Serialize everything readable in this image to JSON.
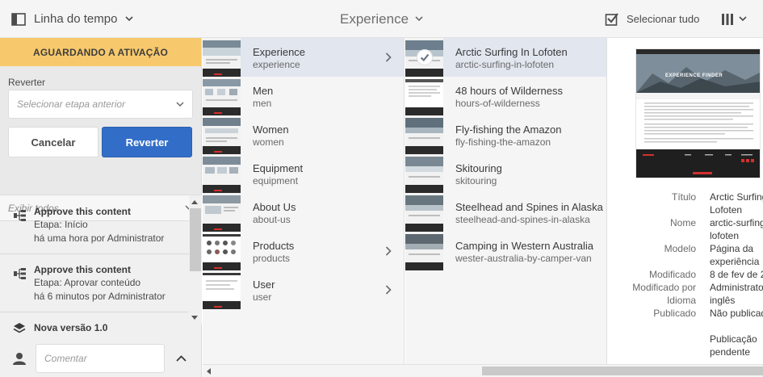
{
  "topbar": {
    "rail_title": "Linha do tempo",
    "breadcrumb": "Experience",
    "select_all": "Selecionar tudo"
  },
  "rail": {
    "banner": "AGUARDANDO A ATIVAÇÃO",
    "revert_label": "Reverter",
    "revert_select_placeholder": "Selecionar etapa anterior",
    "cancel_label": "Cancelar",
    "revert_button": "Reverter",
    "filter_label": "Exibir todos",
    "timeline": [
      {
        "title": "Approve this content",
        "step": "Etapa: Início",
        "time": "há uma hora por Administrator"
      },
      {
        "title": "Approve this content",
        "step": "Etapa: Aprovar conteúdo",
        "time": "há 6 minutos por Administrator"
      }
    ],
    "version": "Nova versão 1.0",
    "comment_placeholder": "Comentar"
  },
  "column1": [
    {
      "title": "Experience",
      "name": "experience",
      "has_children": true,
      "active": true
    },
    {
      "title": "Men",
      "name": "men",
      "has_children": false
    },
    {
      "title": "Women",
      "name": "women",
      "has_children": false
    },
    {
      "title": "Equipment",
      "name": "equipment",
      "has_children": false
    },
    {
      "title": "About Us",
      "name": "about-us",
      "has_children": false
    },
    {
      "title": "Products",
      "name": "products",
      "has_children": true
    },
    {
      "title": "User",
      "name": "user",
      "has_children": true
    }
  ],
  "column2": [
    {
      "title": "Arctic Surfing In Lofoten",
      "name": "arctic-surfing-in-lofoten",
      "selected": true
    },
    {
      "title": "48 hours of Wilderness",
      "name": "hours-of-wilderness"
    },
    {
      "title": "Fly-fishing the Amazon",
      "name": "fly-fishing-the-amazon"
    },
    {
      "title": "Skitouring",
      "name": "skitouring"
    },
    {
      "title": "Steelhead and Spines in Alaska",
      "name": "steelhead-and-spines-in-alaska"
    },
    {
      "title": "Camping in Western Australia",
      "name": "wester-australia-by-camper-van"
    }
  ],
  "preview": {
    "hero_text": "EXPERIENCE FINDER",
    "meta": {
      "titulo_label": "Título",
      "titulo_value_1": "Arctic Surfing",
      "titulo_value_2": "Lofoten",
      "nome_label": "Nome",
      "nome_value_1": "arctic-surfing-",
      "nome_value_2": "lofoten",
      "modelo_label": "Modelo",
      "modelo_value_1": "Página da",
      "modelo_value_2": "experiência",
      "modificado_label": "Modificado",
      "modificado_value": "8 de fev de 20",
      "modificado_por_label": "Modificado por",
      "modificado_por_value": "Administrator",
      "idioma_label": "Idioma",
      "idioma_value": "inglês",
      "publicado_label": "Publicado",
      "publicado_value": "Não publicado",
      "pub_pending_1": "Publicação",
      "pub_pending_2": "pendente"
    }
  },
  "colors": {
    "banner": "#f8c96c",
    "primary": "#326ec8",
    "active_row": "#e1e6ef"
  }
}
